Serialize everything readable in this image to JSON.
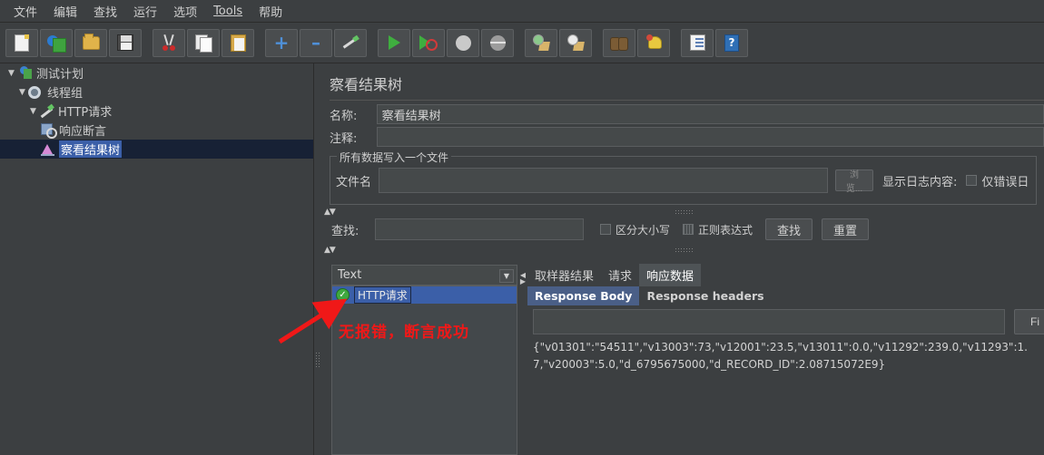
{
  "menu": {
    "items": [
      {
        "label": "文件"
      },
      {
        "label": "编辑"
      },
      {
        "label": "查找"
      },
      {
        "label": "运行"
      },
      {
        "label": "选项"
      },
      {
        "label": "Tools",
        "mnemonic": "T"
      },
      {
        "label": "帮助"
      }
    ]
  },
  "toolbar": {
    "buttons": [
      {
        "name": "new-icon"
      },
      {
        "name": "templates-icon"
      },
      {
        "name": "open-icon"
      },
      {
        "name": "save-icon"
      },
      {
        "name": "cut-icon"
      },
      {
        "name": "copy-icon"
      },
      {
        "name": "paste-icon"
      },
      {
        "name": "expand-all-icon"
      },
      {
        "name": "collapse-all-icon"
      },
      {
        "name": "toggle-icon"
      },
      {
        "name": "start-icon"
      },
      {
        "name": "start-no-pauses-icon"
      },
      {
        "name": "stop-icon"
      },
      {
        "name": "shutdown-icon"
      },
      {
        "name": "clear-icon"
      },
      {
        "name": "clear-all-icon"
      },
      {
        "name": "search-icon"
      },
      {
        "name": "reset-search-icon"
      },
      {
        "name": "function-helper-icon"
      },
      {
        "name": "help-icon"
      }
    ]
  },
  "tree": {
    "nodes": [
      {
        "label": "测试计划",
        "indent": 0,
        "twisty": "▼",
        "icon": "test-plan-icon",
        "selected": false
      },
      {
        "label": "线程组",
        "indent": 1,
        "twisty": "▼",
        "icon": "thread-group-icon",
        "selected": false
      },
      {
        "label": "HTTP请求",
        "indent": 2,
        "twisty": "▼",
        "icon": "http-request-icon",
        "selected": false
      },
      {
        "label": "响应断言",
        "indent": 3,
        "twisty": "",
        "icon": "assertion-icon",
        "selected": false
      },
      {
        "label": "察看结果树",
        "indent": 3,
        "twisty": "",
        "icon": "view-results-tree-icon",
        "selected": true
      }
    ]
  },
  "panel": {
    "title": "察看结果树",
    "name_label": "名称:",
    "name_value": "察看结果树",
    "comment_label": "注释:",
    "comment_value": "",
    "file_group_title": "所有数据写入一个文件",
    "filename_label": "文件名",
    "filename_value": "",
    "browse_label": "浏览...",
    "log_display_label": "显示日志内容:",
    "errors_only_label": "仅错误日",
    "errors_only_checked": false
  },
  "search": {
    "label": "查找:",
    "value": "",
    "case_sensitive_label": "区分大小写",
    "case_sensitive_checked": false,
    "regex_label": "正则表达式",
    "regex_checked": false,
    "find_button": "查找",
    "reset_button": "重置"
  },
  "results": {
    "renderer_selected": "Text",
    "items": [
      {
        "label": "HTTP请求",
        "status": "success",
        "status_icon": "green-check-icon"
      }
    ],
    "tabs": [
      {
        "label": "取样器结果",
        "active": false
      },
      {
        "label": "请求",
        "active": false
      },
      {
        "label": "响应数据",
        "active": true
      }
    ],
    "subtabs": [
      {
        "label": "Response Body",
        "active": true
      },
      {
        "label": "Response headers",
        "active": false
      }
    ],
    "find_value": "",
    "find_button": "Fi",
    "response_body": "{\"v01301\":\"54511\",\"v13003\":73,\"v12001\":23.5,\"v13011\":0.0,\"v11292\":239.0,\"v11293\":1.7,\"v20003\":5.0,\"d_6795675000,\"d_RECORD_ID\":2.08715072E9}"
  },
  "annotation": {
    "text": "无报错，断言成功",
    "color": "#f01818"
  },
  "colors": {
    "background": "#3c3f41",
    "selection_blue": "#3b5fa8",
    "tree_selection": "#172135",
    "accent_red": "#f01818"
  }
}
